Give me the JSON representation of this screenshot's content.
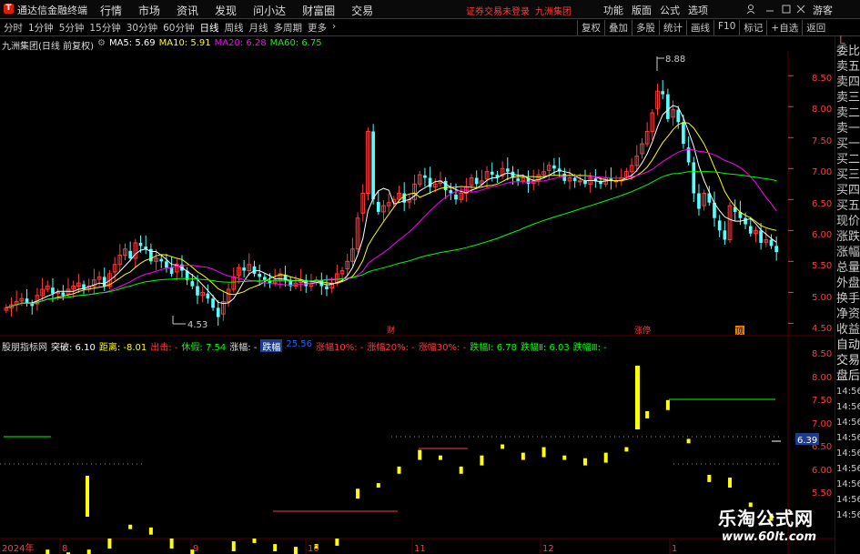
{
  "menubar": {
    "logo": "T",
    "app_title": "通达信金融终端",
    "menus": [
      "行情",
      "市场",
      "资讯",
      "发现",
      "问小达",
      "财富圈",
      "交易"
    ],
    "notice": "证券交易未登录",
    "stock_name": "九洲集团",
    "right_items": [
      "功能",
      "版面",
      "公式",
      "选项"
    ],
    "guest": "游客"
  },
  "toolbar": {
    "periods": [
      "分时",
      "1分钟",
      "5分钟",
      "15分钟",
      "30分钟",
      "60分钟",
      "日线",
      "周线",
      "月线",
      "多周期",
      "更多"
    ],
    "active_period": "日线",
    "tools": [
      "复权",
      "叠加",
      "多股",
      "统计",
      "画线",
      "F10",
      "标记",
      "+自选",
      "返回"
    ]
  },
  "info": {
    "name": "九洲集团(日线 前复权)",
    "ma5": "MA5: 5.69",
    "ma10": "MA10: 5.91",
    "ma20": "MA20: 6.28",
    "ma60": "MA60: 6.75",
    "ma5_color": "#ffffff",
    "ma10_color": "#ffff00",
    "ma20_color": "#ff00ff",
    "ma60_color": "#00ff00"
  },
  "indicator": {
    "name": "股朋指标网",
    "breakout": "突破: 6.10",
    "distance": "距离: -8.01",
    "exit": "出击: -",
    "rest": "休假: 7.54",
    "rise": "涨幅: -",
    "fall_label": "跌幅",
    "fall_value": "25.56",
    "rise10": "涨幅10%: -",
    "rise20": "涨幅20%: -",
    "rise30": "涨幅30%: -",
    "fall1": "跌幅Ⅰ: 6.78",
    "fall2": "跌幅Ⅱ: 6.03",
    "fall3": "跌幅Ⅲ: -"
  },
  "right_panel": {
    "flag": "L",
    "items": [
      "委比",
      "卖五",
      "卖四",
      "卖三",
      "卖二",
      "卖一",
      "买一",
      "买二",
      "买三",
      "买四",
      "买五",
      "现价",
      "涨跌",
      "涨幅",
      "总量",
      "外盘",
      "换手",
      "净资",
      "收益",
      "自动",
      "交易",
      "盘后",
      "14:56",
      "14:56",
      "14:56",
      "14:56",
      "14:56",
      "14:56",
      "14:56",
      "14:56",
      "14:56"
    ]
  },
  "price_axis": [
    "8.50",
    "8.00",
    "7.50",
    "7.00",
    "6.50",
    "6.00",
    "5.50",
    "5.00",
    "4.50"
  ],
  "ind_axis": [
    "8.50",
    "8.00",
    "7.50",
    "7.00",
    "6.50",
    "6.00",
    "5.50"
  ],
  "ind_axis_marker": "6.39",
  "date_axis": [
    "2024年",
    "8",
    "9",
    "10",
    "11",
    "12",
    "1"
  ],
  "annotations": {
    "high": "8.88",
    "low": "4.53",
    "fin_marker": "财",
    "limit_marker": "涨停",
    "bottom_marker": "顶"
  },
  "chart_data": {
    "type": "candlestick",
    "title": "九洲集团(日线 前复权)",
    "ylim": [
      4.3,
      8.9
    ],
    "high": 8.88,
    "low": 4.53,
    "closes": [
      4.75,
      4.8,
      4.85,
      4.9,
      4.82,
      4.78,
      4.95,
      5.05,
      5.1,
      4.98,
      5.0,
      4.95,
      5.05,
      5.1,
      5.15,
      5.05,
      5.1,
      5.2,
      5.25,
      5.1,
      5.3,
      5.45,
      5.6,
      5.7,
      5.55,
      5.8,
      5.75,
      5.7,
      5.5,
      5.55,
      5.5,
      5.4,
      5.3,
      5.45,
      5.35,
      5.2,
      5.1,
      4.95,
      5.0,
      4.9,
      4.75,
      4.6,
      4.85,
      5.05,
      5.25,
      5.4,
      5.35,
      5.45,
      5.3,
      5.25,
      5.2,
      5.15,
      5.2,
      5.3,
      5.2,
      5.1,
      5.15,
      5.2,
      5.1,
      5.15,
      5.2,
      5.1,
      5.05,
      5.15,
      5.3,
      5.35,
      5.5,
      5.7,
      6.2,
      6.6,
      7.6,
      6.5,
      6.3,
      6.4,
      6.45,
      6.5,
      6.6,
      6.45,
      6.5,
      6.75,
      6.9,
      6.85,
      6.7,
      6.75,
      6.8,
      6.65,
      6.6,
      6.5,
      6.6,
      6.7,
      6.85,
      6.75,
      6.8,
      6.95,
      6.9,
      6.85,
      7.0,
      6.95,
      6.85,
      6.8,
      6.85,
      6.75,
      6.8,
      6.9,
      6.95,
      7.05,
      7.0,
      6.95,
      6.8,
      6.85,
      6.8,
      6.8,
      6.75,
      6.85,
      6.8,
      6.75,
      6.85,
      6.8,
      6.8,
      6.85,
      6.95,
      7.05,
      7.2,
      7.4,
      7.6,
      7.9,
      8.25,
      8.2,
      7.8,
      7.95,
      7.75,
      7.4,
      7.1,
      6.6,
      6.35,
      6.6,
      6.45,
      6.2,
      6.0,
      5.85,
      6.4,
      6.3,
      6.2,
      6.1,
      5.95,
      6.0,
      5.8,
      5.85,
      5.75,
      5.65
    ]
  }
}
